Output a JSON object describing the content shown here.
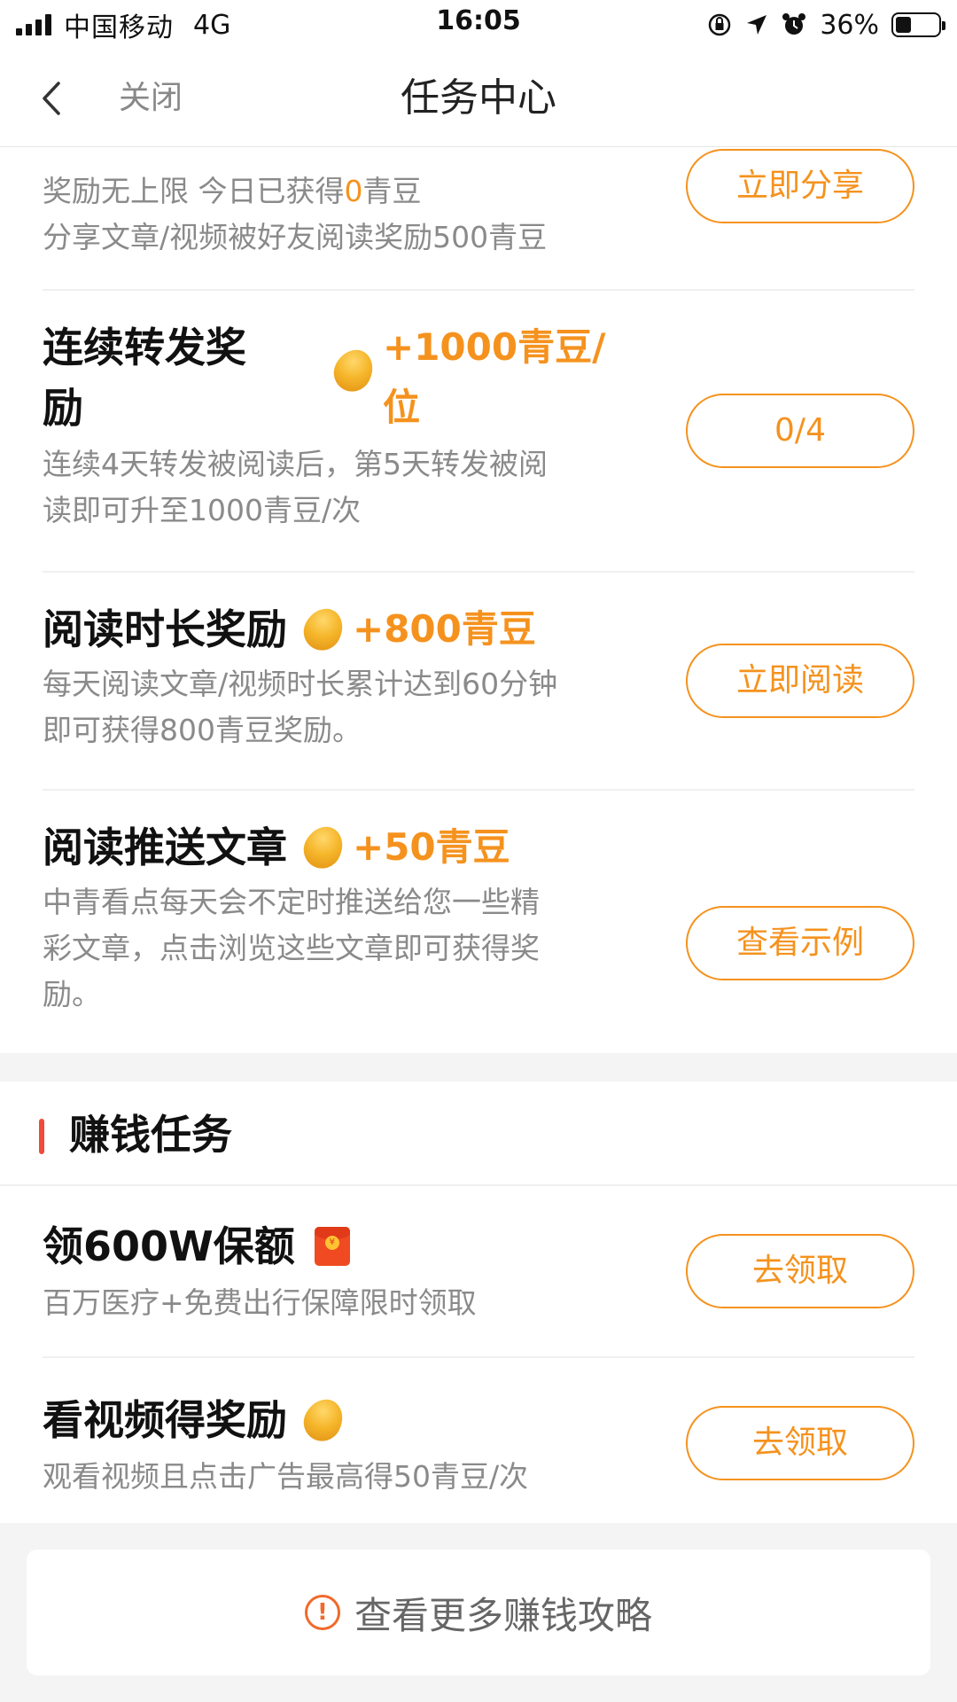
{
  "status_bar": {
    "carrier": "中国移动",
    "network": "4G",
    "time": "16:05",
    "battery": "36%",
    "battery_level": 0.36,
    "icons": [
      "orientation-lock-icon",
      "location-icon",
      "alarm-icon"
    ]
  },
  "nav": {
    "back_icon": "chevron-left-icon",
    "close_label": "关闭",
    "title": "任务中心"
  },
  "tasks_daily": [
    {
      "title": "",
      "reward": "",
      "desc_line1_prefix": "奖励无上限 今日已获得",
      "desc_line1_highlight": "0",
      "desc_line1_suffix": "青豆",
      "desc_line2": "分享文章/视频被好友阅读奖励500青豆",
      "button": "立即分享"
    },
    {
      "title_line1": "连续转发奖",
      "title_line2": "励",
      "reward_line1": "+1000青豆/",
      "reward_line2": "位",
      "desc_line1": "连续4天转发被阅读后，第5天转发被阅",
      "desc_line2": "读即可升至1000青豆/次",
      "button": "0/4"
    },
    {
      "title": "阅读时长奖励",
      "reward": "+800青豆",
      "desc_line1": "每天阅读文章/视频时长累计达到60分钟",
      "desc_line2": "即可获得800青豆奖励。",
      "button": "立即阅读"
    },
    {
      "title": "阅读推送文章",
      "reward": "+50青豆",
      "desc_line1": "中青看点每天会不定时推送给您一些精",
      "desc_line2": "彩文章，点击浏览这些文章即可获得奖",
      "desc_line3": "励。",
      "button": "查看示例"
    }
  ],
  "earn_section": {
    "title": "赚钱任务",
    "tasks": [
      {
        "title": "领600W保额",
        "desc": "百万医疗+免费出行保障限时领取",
        "button": "去领取",
        "icon": "red-packet-icon"
      },
      {
        "title": "看视频得奖励",
        "desc": "观看视频且点击广告最高得50青豆/次",
        "button": "去领取",
        "icon": "bean-icon"
      }
    ]
  },
  "footer": {
    "guide_label": "查看更多赚钱攻略",
    "icon": "exclamation-circle-icon"
  },
  "colors": {
    "accent": "#f5921e",
    "section_bar": "#f04a3a",
    "muted_text": "#8a8a8a"
  }
}
